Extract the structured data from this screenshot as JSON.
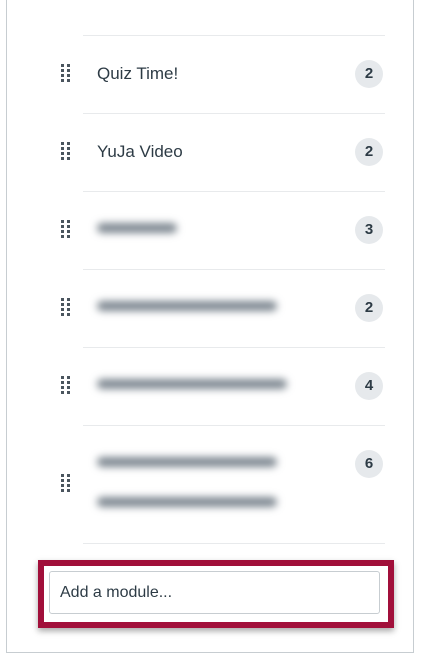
{
  "modules": [
    {
      "name": "Quiz Time!",
      "count": "2",
      "blurred": false
    },
    {
      "name": "YuJa Video",
      "count": "2",
      "blurred": false
    },
    {
      "name": "",
      "count": "3",
      "blurred": true
    },
    {
      "name": "",
      "count": "2",
      "blurred": true
    },
    {
      "name": "",
      "count": "4",
      "blurred": true
    },
    {
      "name": "",
      "count": "6",
      "blurred": true
    }
  ],
  "add_module": {
    "placeholder": "Add a module...",
    "highlight_color": "#a10f3a"
  },
  "colors": {
    "badge_background": "#e6e9ec",
    "text": "#2d3b45",
    "divider": "#e8eaec"
  }
}
